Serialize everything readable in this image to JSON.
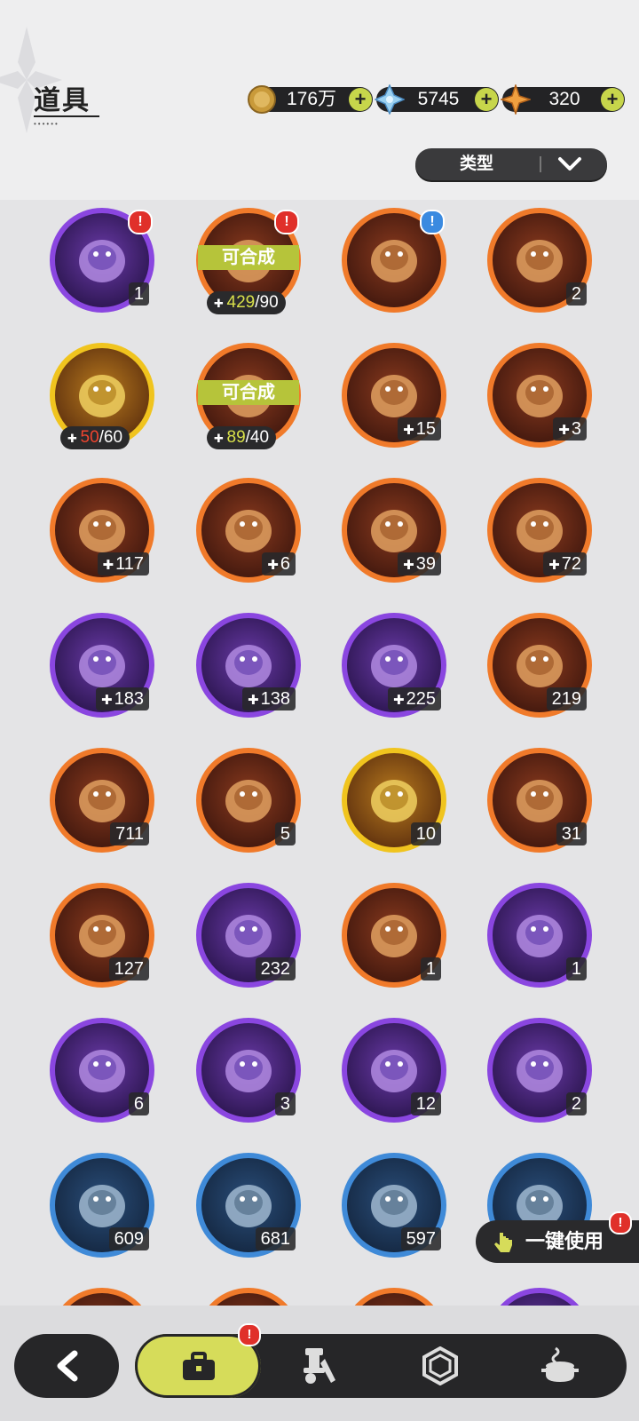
{
  "header": {
    "title": "道具"
  },
  "currencies": [
    {
      "name": "gold-coin",
      "value": "176万"
    },
    {
      "name": "blue-crystal",
      "value": "5745"
    },
    {
      "name": "orange-star-crystal",
      "value": "320"
    }
  ],
  "filter": {
    "label": "类型"
  },
  "items": [
    {
      "icon": "mystery-gift-box",
      "ring": "purple",
      "count": "1",
      "badge": "!",
      "badge_kind": "alert"
    },
    {
      "icon": "fragment-box",
      "ring": "orange",
      "badge": "!",
      "badge_kind": "alert",
      "synth_label": "可合成",
      "frag_have": "429",
      "frag_need": "/90",
      "frag_ok": true
    },
    {
      "icon": "treasure-chest",
      "ring": "orange",
      "badge": "!",
      "badge_kind": "info"
    },
    {
      "icon": "purple-crystal-card",
      "ring": "orange",
      "count": "2"
    },
    {
      "icon": "mystery-fragment",
      "ring": "gold",
      "frag_have": "50",
      "frag_need": "/60",
      "frag_ok": false
    },
    {
      "icon": "fragment-box",
      "ring": "orange",
      "synth_label": "可合成",
      "frag_have": "89",
      "frag_need": "/40",
      "frag_ok": true
    },
    {
      "icon": "teal-bird-creature",
      "ring": "orange",
      "count": "15",
      "puzzle": true
    },
    {
      "icon": "masked-creature",
      "ring": "orange",
      "count": "3",
      "puzzle": true
    },
    {
      "icon": "brown-bear-creature",
      "ring": "orange",
      "count": "117",
      "puzzle": true
    },
    {
      "icon": "knight-creature",
      "ring": "orange",
      "count": "6",
      "puzzle": true
    },
    {
      "icon": "eyepatch-bear",
      "ring": "orange",
      "count": "39",
      "puzzle": true
    },
    {
      "icon": "lavender-creature",
      "ring": "orange",
      "count": "72",
      "puzzle": true
    },
    {
      "icon": "leaf-creature",
      "ring": "purple",
      "count": "183",
      "puzzle": true
    },
    {
      "icon": "red-eye-bear",
      "ring": "purple",
      "count": "138",
      "puzzle": true
    },
    {
      "icon": "yellow-chick",
      "ring": "purple",
      "count": "225",
      "puzzle": true
    },
    {
      "icon": "pink-crystal-star",
      "ring": "orange",
      "count": "219"
    },
    {
      "icon": "blue-crystal-star",
      "ring": "orange",
      "count": "711"
    },
    {
      "icon": "paw-charm",
      "ring": "orange",
      "count": "5"
    },
    {
      "icon": "gold-character-card",
      "ring": "gold",
      "count": "10"
    },
    {
      "icon": "blue-character-card",
      "ring": "orange",
      "count": "31"
    },
    {
      "icon": "orange-character-card",
      "ring": "orange",
      "count": "127"
    },
    {
      "icon": "purple-character-card",
      "ring": "purple",
      "count": "232"
    },
    {
      "icon": "dolphin-card",
      "ring": "orange",
      "count": "1"
    },
    {
      "icon": "rose-gift-box",
      "ring": "purple",
      "count": "1"
    },
    {
      "icon": "gold-pouch",
      "ring": "purple",
      "count": "6"
    },
    {
      "icon": "magic-mirror",
      "ring": "purple",
      "count": "3"
    },
    {
      "icon": "scroll",
      "ring": "purple",
      "count": "12"
    },
    {
      "icon": "pink-apple",
      "ring": "purple",
      "count": "2"
    },
    {
      "icon": "shovel",
      "ring": "blue",
      "count": "609"
    },
    {
      "icon": "glove",
      "ring": "blue",
      "count": "681"
    },
    {
      "icon": "pickaxe",
      "ring": "blue",
      "count": "597"
    },
    {
      "icon": "hammer",
      "ring": "blue",
      "count": ""
    },
    {
      "icon": "partial-item",
      "ring": "orange",
      "count": ""
    },
    {
      "icon": "partial-item",
      "ring": "orange",
      "count": ""
    },
    {
      "icon": "partial-item",
      "ring": "orange",
      "count": ""
    },
    {
      "icon": "partial-item",
      "ring": "purple",
      "count": ""
    }
  ],
  "quick_use": {
    "label": "一键使用",
    "badge": "!"
  },
  "bottom_nav": {
    "back_icon": "back-arrow-icon",
    "tabs": [
      {
        "name": "bag",
        "icon": "briefcase-icon",
        "active": true,
        "badge": "!"
      },
      {
        "name": "equipment",
        "icon": "gear-tools-icon",
        "active": false
      },
      {
        "name": "gems",
        "icon": "hexagon-gem-icon",
        "active": false
      },
      {
        "name": "cooking",
        "icon": "pot-icon",
        "active": false
      }
    ]
  },
  "colors": {
    "accent": "#d6dc5a",
    "alert": "#e0302a",
    "info": "#3a8ae0",
    "synth": "#b6c43a"
  }
}
